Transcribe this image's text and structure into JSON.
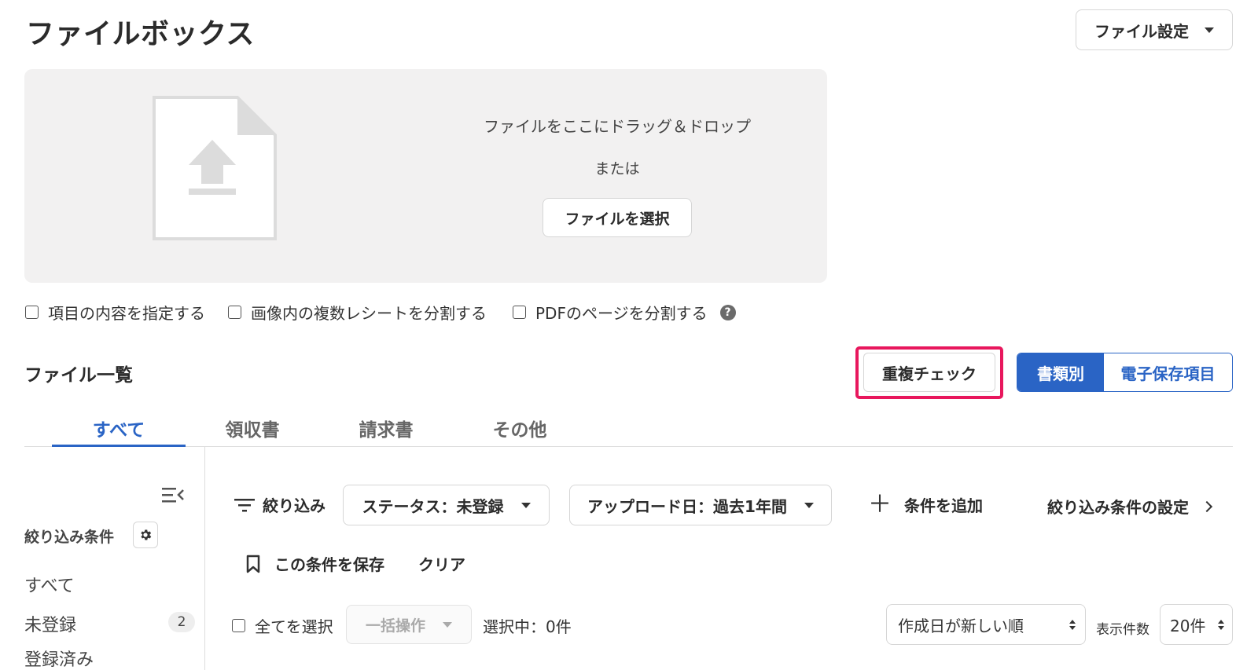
{
  "header": {
    "title": "ファイルボックス",
    "settings_label": "ファイル設定"
  },
  "dropzone": {
    "drop_text": "ファイルをここにドラッグ＆ドロップ",
    "or_text": "または",
    "select_label": "ファイルを選択"
  },
  "options": [
    {
      "label": "項目の内容を指定する",
      "checked": false
    },
    {
      "label": "画像内の複数レシートを分割する",
      "checked": false
    },
    {
      "label": "PDFのページを分割する",
      "checked": false
    }
  ],
  "help_glyph": "?",
  "file_list": {
    "title": "ファイル一覧",
    "duplicate_check_label": "重複チェック",
    "view_toggle": {
      "by_document": "書類別",
      "electronic_items": "電子保存項目",
      "active": "by_document"
    }
  },
  "tabs": [
    {
      "label": "すべて",
      "active": true
    },
    {
      "label": "領収書",
      "active": false
    },
    {
      "label": "請求書",
      "active": false
    },
    {
      "label": "その他",
      "active": false
    }
  ],
  "sidebar": {
    "title": "絞り込み条件",
    "items": [
      {
        "label": "すべて"
      },
      {
        "label": "未登録",
        "count": "2"
      },
      {
        "label": "登録済み"
      }
    ]
  },
  "filters": {
    "label": "絞り込み",
    "status_pill": "ステータス：未登録",
    "date_pill": "アップロード日：過去1年間",
    "add_condition": "条件を追加",
    "settings_link": "絞り込み条件の設定",
    "save_condition": "この条件を保存",
    "clear": "クリア"
  },
  "list_controls": {
    "select_all": "全てを選択",
    "bulk_action": "一括操作",
    "selected_count": "選択中：0件",
    "sort_value": "作成日が新しい順",
    "per_page_label": "表示件数",
    "per_page_value": "20件"
  },
  "colors": {
    "accent": "#2a64c5",
    "highlight": "#e8175d",
    "dropzone_bg": "#f2f1f1"
  },
  "icons": [
    "file-upload-icon",
    "help-icon",
    "collapse-sidebar-icon",
    "gear-icon",
    "filter-icon",
    "plus-icon",
    "chevron-right-icon",
    "bookmark-icon",
    "caret-down-icon",
    "sort-updown-icon"
  ]
}
